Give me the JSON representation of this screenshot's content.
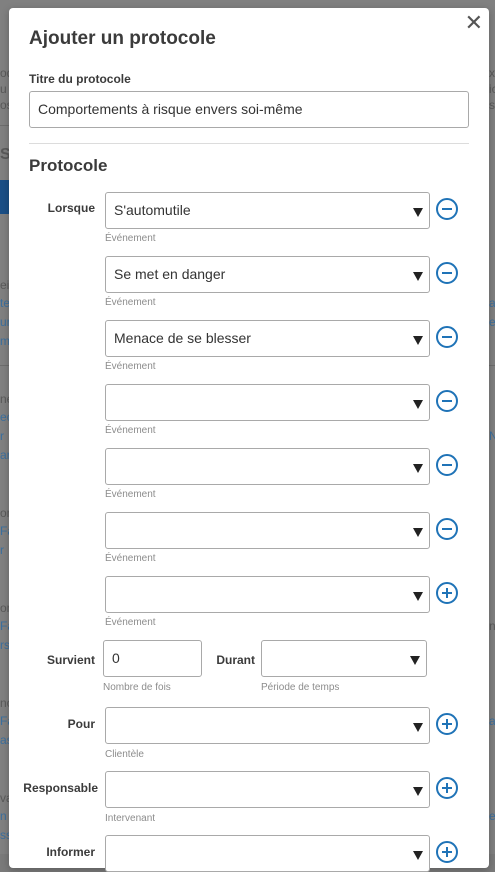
{
  "background": {
    "fragments_left": [
      "od",
      "u",
      "os",
      "S",
      "ei",
      "te",
      "ur",
      "m",
      "ne",
      "ec",
      "r",
      "ar",
      "on",
      "Fa",
      "r",
      "on",
      "Fa",
      "rs",
      "no",
      "Fa",
      "as",
      "va",
      "n",
      "ss"
    ],
    "fragments_right": [
      "xt",
      "ic",
      "s.",
      "a",
      "e",
      "N",
      "nt",
      "a",
      "e"
    ]
  },
  "modal": {
    "title": "Ajouter un protocole",
    "close_glyph": "✕",
    "protocol_title_label": "Titre du protocole",
    "protocol_title_value": "Comportements à risque envers soi-même",
    "section_title": "Protocole",
    "when_label": "Lorsque",
    "event_helper": "Événement",
    "events": [
      {
        "value": "S'automutile",
        "action": "remove"
      },
      {
        "value": "Se met en danger",
        "action": "remove"
      },
      {
        "value": "Menace de se blesser",
        "action": "remove"
      },
      {
        "value": "",
        "action": "remove"
      },
      {
        "value": "",
        "action": "remove"
      },
      {
        "value": "",
        "action": "remove"
      },
      {
        "value": "",
        "action": "add"
      }
    ],
    "occurs_label": "Survient",
    "occurs_value": "0",
    "occurs_helper": "Nombre de fois",
    "during_label": "Durant",
    "during_value": "",
    "during_helper": "Période de temps",
    "for_label": "Pour",
    "for_value": "",
    "for_helper": "Clientèle",
    "responsible_label": "Responsable",
    "responsible_value": "",
    "responsible_helper": "Intervenant",
    "inform_label": "Informer",
    "inform_value": ""
  },
  "colors": {
    "accent": "#1f73b7",
    "overlay": "#808080"
  }
}
